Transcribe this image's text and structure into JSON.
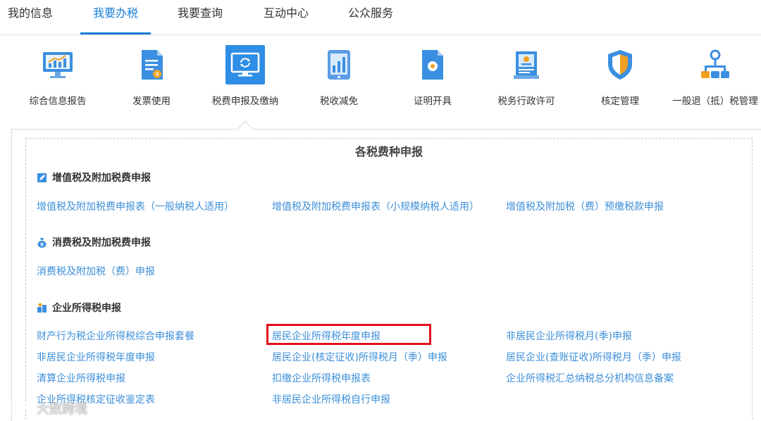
{
  "nav": {
    "tabs": [
      {
        "label": "我的信息"
      },
      {
        "label": "我要办税"
      },
      {
        "label": "我要查询"
      },
      {
        "label": "互动中心"
      },
      {
        "label": "公众服务"
      }
    ],
    "active_index": 1
  },
  "services": [
    {
      "label": "综合信息报告",
      "icon": "monitor-chart-icon"
    },
    {
      "label": "发票使用",
      "icon": "invoice-doc-icon"
    },
    {
      "label": "税费申报及缴纳",
      "icon": "screen-refresh-icon",
      "selected": true
    },
    {
      "label": "税收减免",
      "icon": "bar-chart-phone-icon"
    },
    {
      "label": "证明开具",
      "icon": "certificate-doc-icon"
    },
    {
      "label": "税务行政许可",
      "icon": "license-book-icon"
    },
    {
      "label": "核定管理",
      "icon": "shield-icon"
    },
    {
      "label": "一般退（抵）税管理",
      "icon": "org-tree-icon"
    }
  ],
  "panel": {
    "title": "各税费种申报",
    "sections": [
      {
        "title": "增值税及附加税费申报",
        "icon": "edit-icon",
        "links": [
          "增值税及附加税费申报表（一般纳税人适用）",
          "增值税及附加税费申报表（小规模纳税人适用）",
          "增值税及附加税（费）预缴税款申报"
        ]
      },
      {
        "title": "消费税及附加税费申报",
        "icon": "money-bag-icon",
        "links": [
          "消费税及附加税（费）申报"
        ]
      },
      {
        "title": "企业所得税申报",
        "icon": "coins-icon",
        "links": [
          "财产行为税企业所得税综合申报套餐",
          "居民企业所得税年度申报",
          "非居民企业所得税月(季)申报",
          "非居民企业所得税年度申报",
          "居民企业(核定征收)所得税月（季）申报",
          "居民企业(查账征收)所得税月（季）申报",
          "清算企业所得税申报",
          "扣缴企业所得税申报表",
          "企业所得税汇总纳税总分机构信息备案",
          "企业所得税核定征收鉴定表",
          "非居民企业所得税自行申报"
        ]
      }
    ]
  },
  "watermark": "大数跨境",
  "colors": {
    "accent": "#1a7ed8",
    "link": "#3d8fd9",
    "highlight": "#e0101b"
  }
}
